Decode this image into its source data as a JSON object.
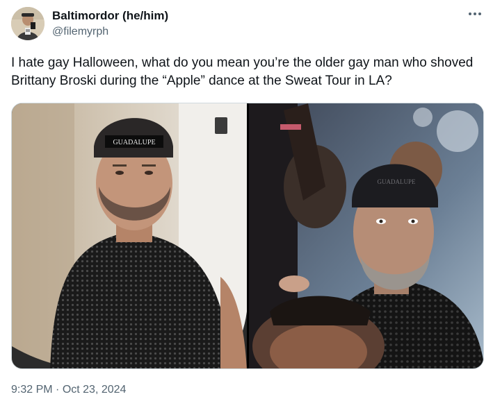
{
  "author": {
    "display_name": "Baltimordor (he/him)",
    "handle": "@filemyrph"
  },
  "tweet": {
    "text": "I hate gay Halloween, what do you mean you’re the older gay man who shoved Brittany Broski during the “Apple” dance at the Sweat Tour in LA?",
    "time": "9:32 PM",
    "separator": " · ",
    "date": "Oct 23, 2024"
  },
  "media": {
    "left_photo_cap_text": "GUADALUPE",
    "right_photo_cap_text": "GUADALUPE"
  },
  "icons": {
    "more": "more-dots-icon"
  },
  "colors": {
    "text_primary": "#0f1419",
    "text_secondary": "#536471",
    "border": "#cfd9de"
  }
}
